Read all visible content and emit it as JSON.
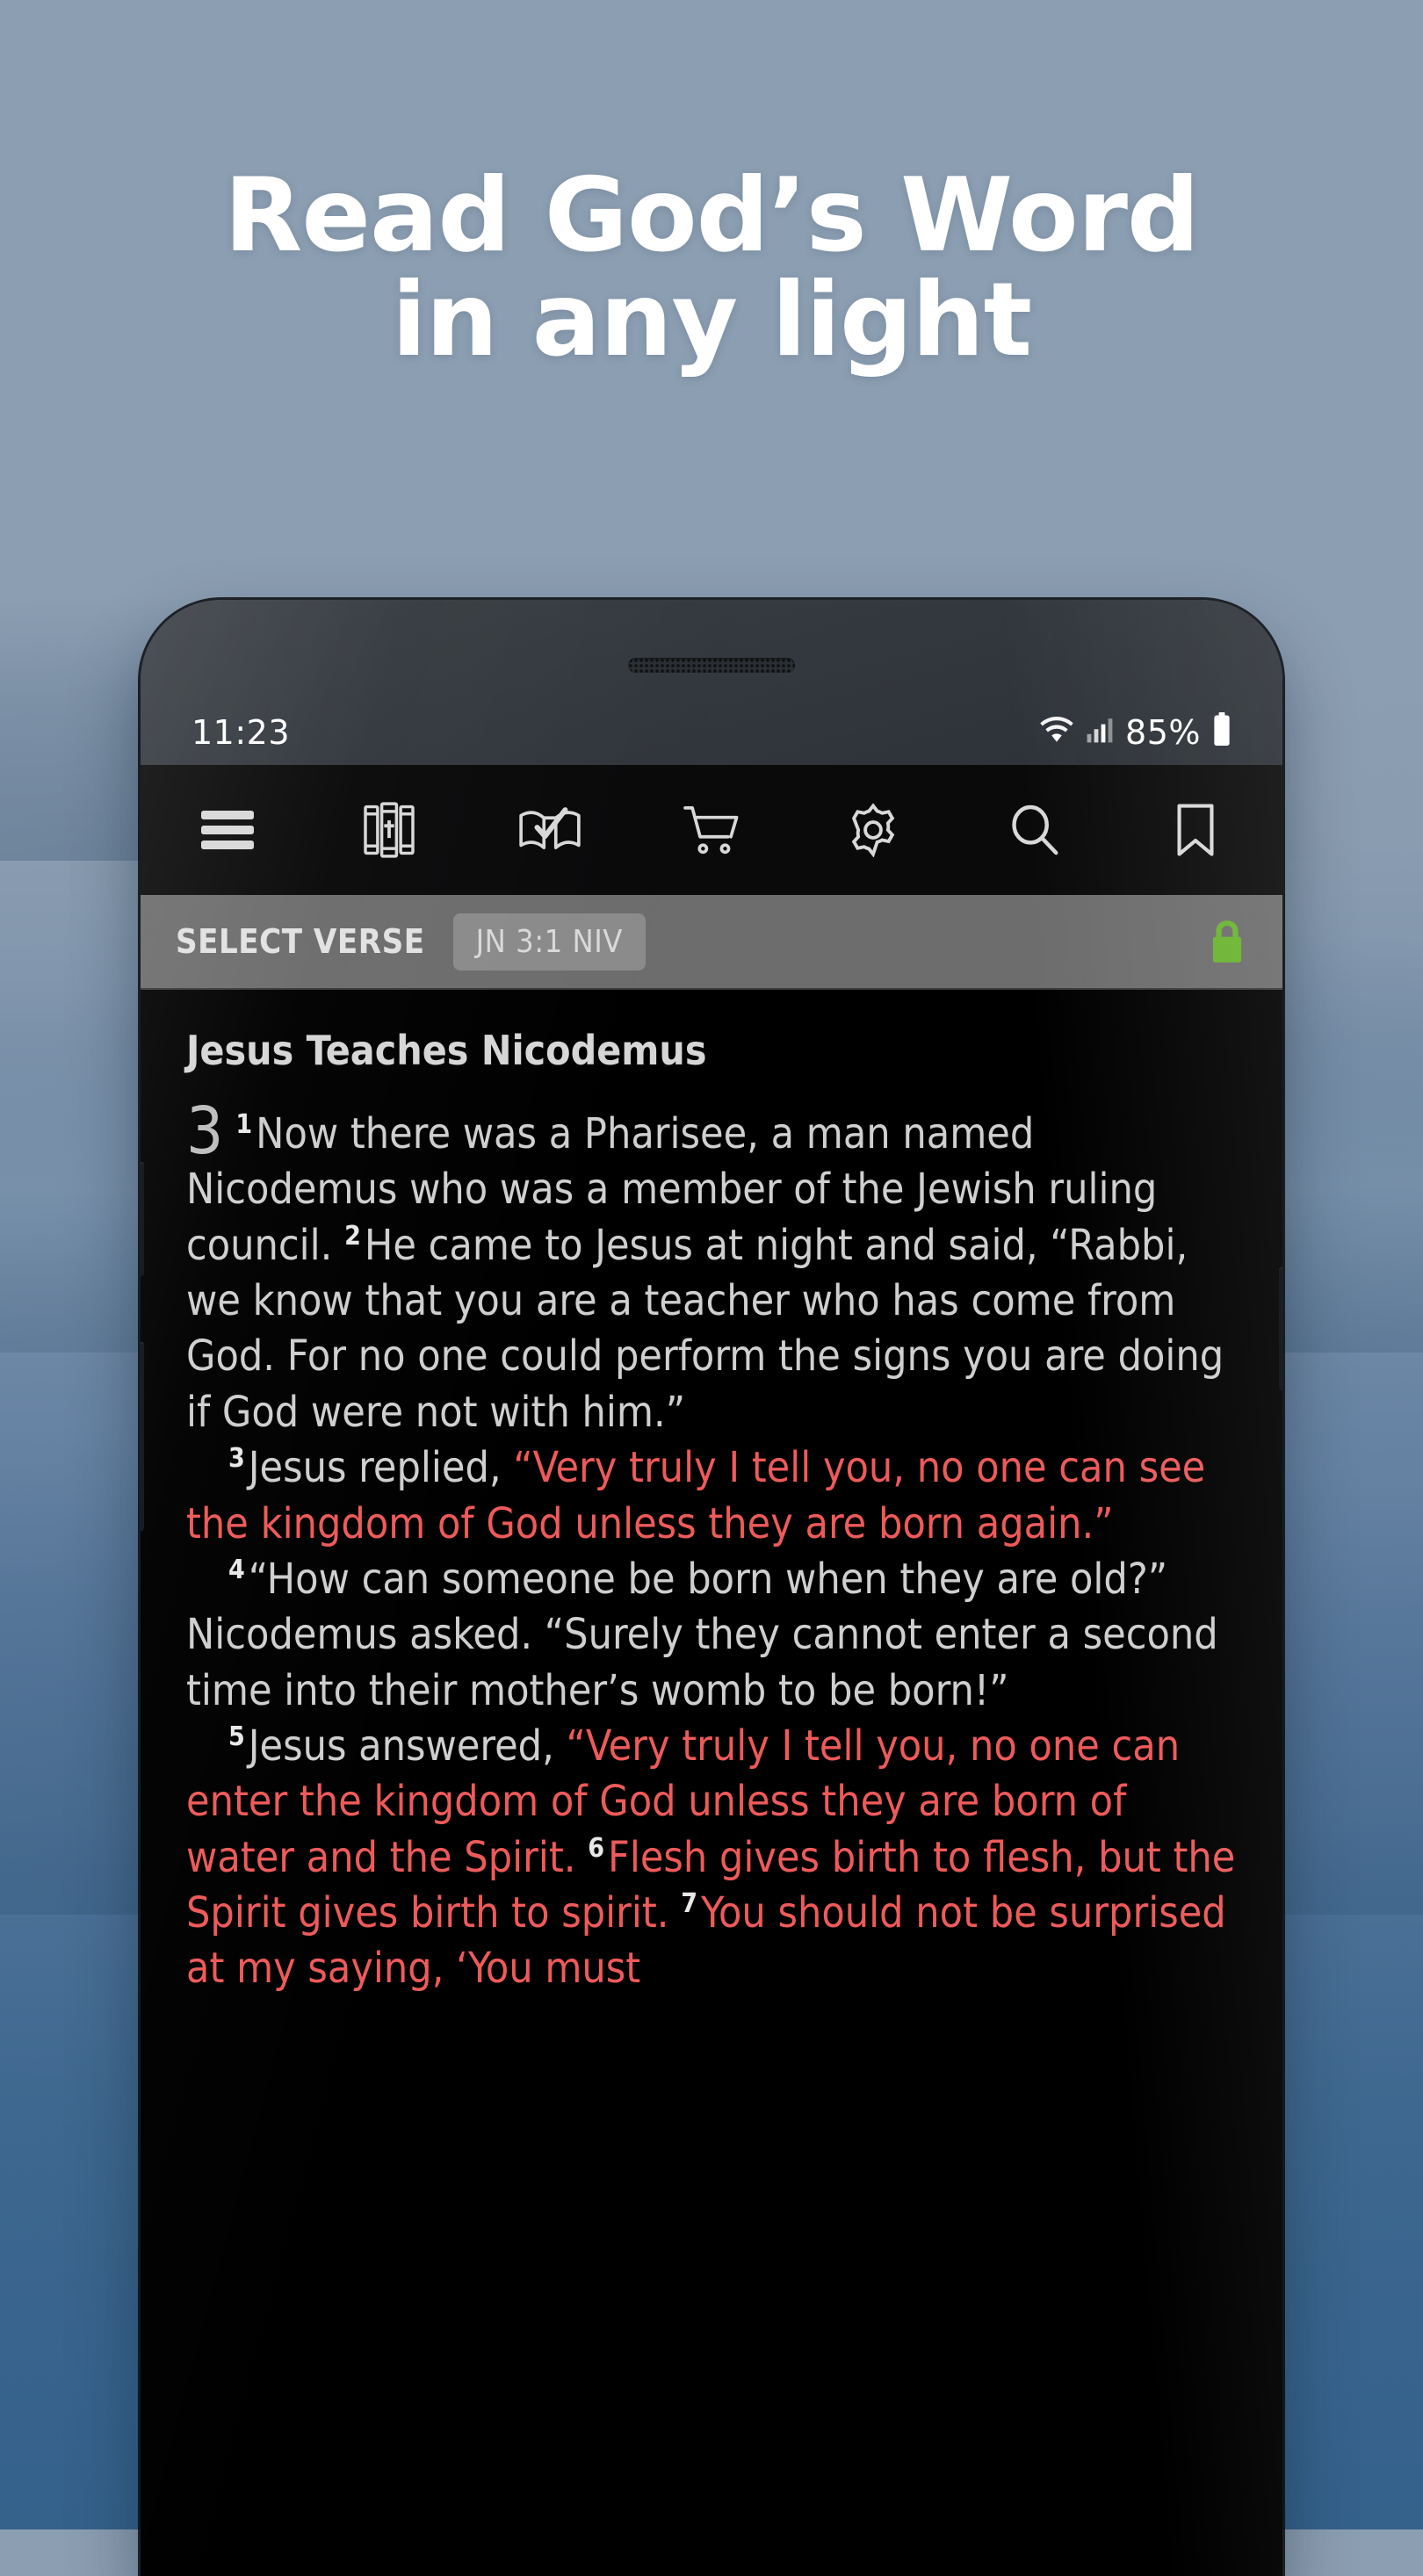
{
  "headline": {
    "line1": "Read God’s Word",
    "line2": "in any light"
  },
  "colors": {
    "background_top": "#8c9eb2",
    "background_bottom": "#3d6894",
    "screen_background": "#000000",
    "verse_bar": "#6d6d6d",
    "jesus_words": "#ee5a5a",
    "lock_green": "#6ab42f",
    "body_text": "#cfcfcf"
  },
  "phone": {
    "status_bar": {
      "time": "11:23",
      "battery_percent": "85%",
      "wifi_icon": "wifi-icon",
      "signal_icon": "cell-signal-icon",
      "battery_icon": "battery-icon"
    },
    "toolbar": {
      "items": [
        {
          "name": "menu-icon",
          "label": "Menu"
        },
        {
          "name": "bible-library-icon",
          "label": "Library"
        },
        {
          "name": "reading-plan-icon",
          "label": "Reading Plan"
        },
        {
          "name": "store-cart-icon",
          "label": "Store"
        },
        {
          "name": "settings-gear-icon",
          "label": "Settings"
        },
        {
          "name": "search-icon",
          "label": "Search"
        },
        {
          "name": "bookmark-icon",
          "label": "Bookmark"
        }
      ]
    },
    "verse_bar": {
      "label": "SELECT VERSE",
      "chip": "JN 3:1 NIV",
      "lock_icon": "lock-closed-icon"
    },
    "reader": {
      "chapter_title": "Jesus Teaches Nicodemus",
      "chapter_number": "3",
      "verses": [
        {
          "number": "1",
          "text": "Now there was a Pharisee, a man named Nicodemus who was a member of the Jewish ruling council.",
          "red": false
        },
        {
          "number": "2",
          "text": "He came to Jesus at night and said, “Rabbi, we know that you are a teacher who has come from God. For no one could perform the signs you are doing if God were not with him.”",
          "red": false
        },
        {
          "number": "3",
          "lead": "Jesus replied, ",
          "text": "“Very truly I tell you, no one can see the kingdom of God unless they are born again.”",
          "red": true
        },
        {
          "number": "4",
          "text": "“How can someone be born when they are old?” Nicodemus asked. “Surely they cannot enter a second time into their mother’s womb to be born!”",
          "red": false
        },
        {
          "number": "5",
          "lead": "Jesus answered, ",
          "text": "“Very truly I tell you, no one can enter the kingdom of God unless they are born of water and the Spirit.",
          "red": true
        },
        {
          "number": "6",
          "text": "Flesh gives birth to flesh, but the Spirit gives birth to spirit.",
          "red": true
        },
        {
          "number": "7",
          "text": "You should not be surprised at my saying, ‘You must",
          "red": true
        }
      ]
    }
  }
}
